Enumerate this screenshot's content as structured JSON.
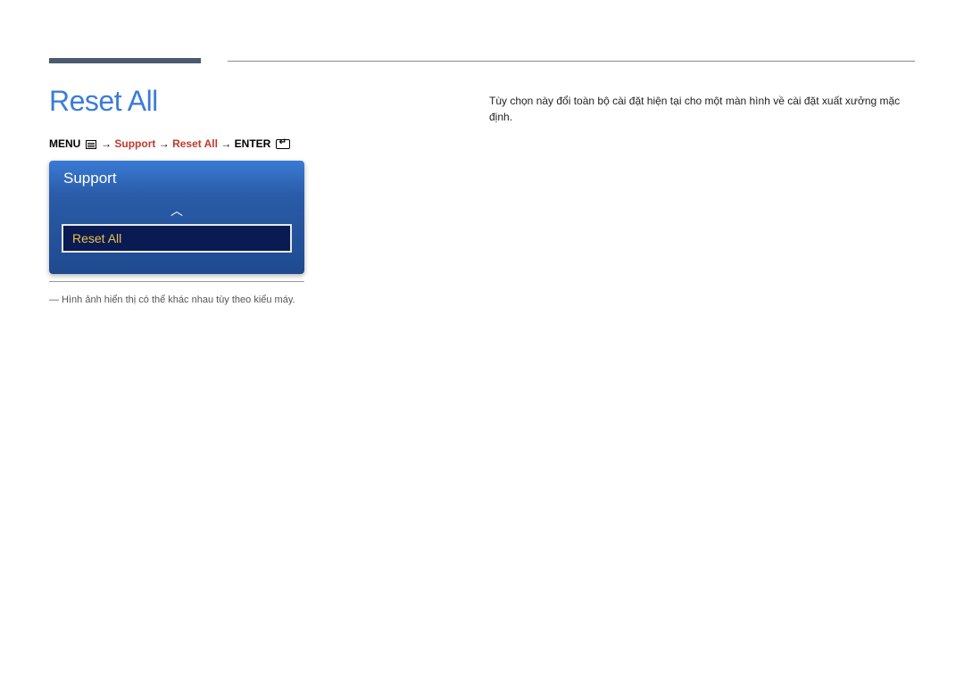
{
  "page": {
    "title": "Reset All"
  },
  "breadcrumb": {
    "menu": "MENU",
    "arrow1": " → ",
    "support": "Support",
    "arrow2": " → ",
    "resetAll": "Reset All",
    "arrow3": " → ",
    "enter": "ENTER"
  },
  "osd": {
    "header": "Support",
    "selectedItem": "Reset All"
  },
  "footnote": "― Hình ảnh hiển thị có thể khác nhau tùy theo kiểu máy.",
  "description": "Tùy chọn này đổi toàn bộ cài đặt hiện tại cho một màn hình về cài đặt xuất xưởng mặc định."
}
